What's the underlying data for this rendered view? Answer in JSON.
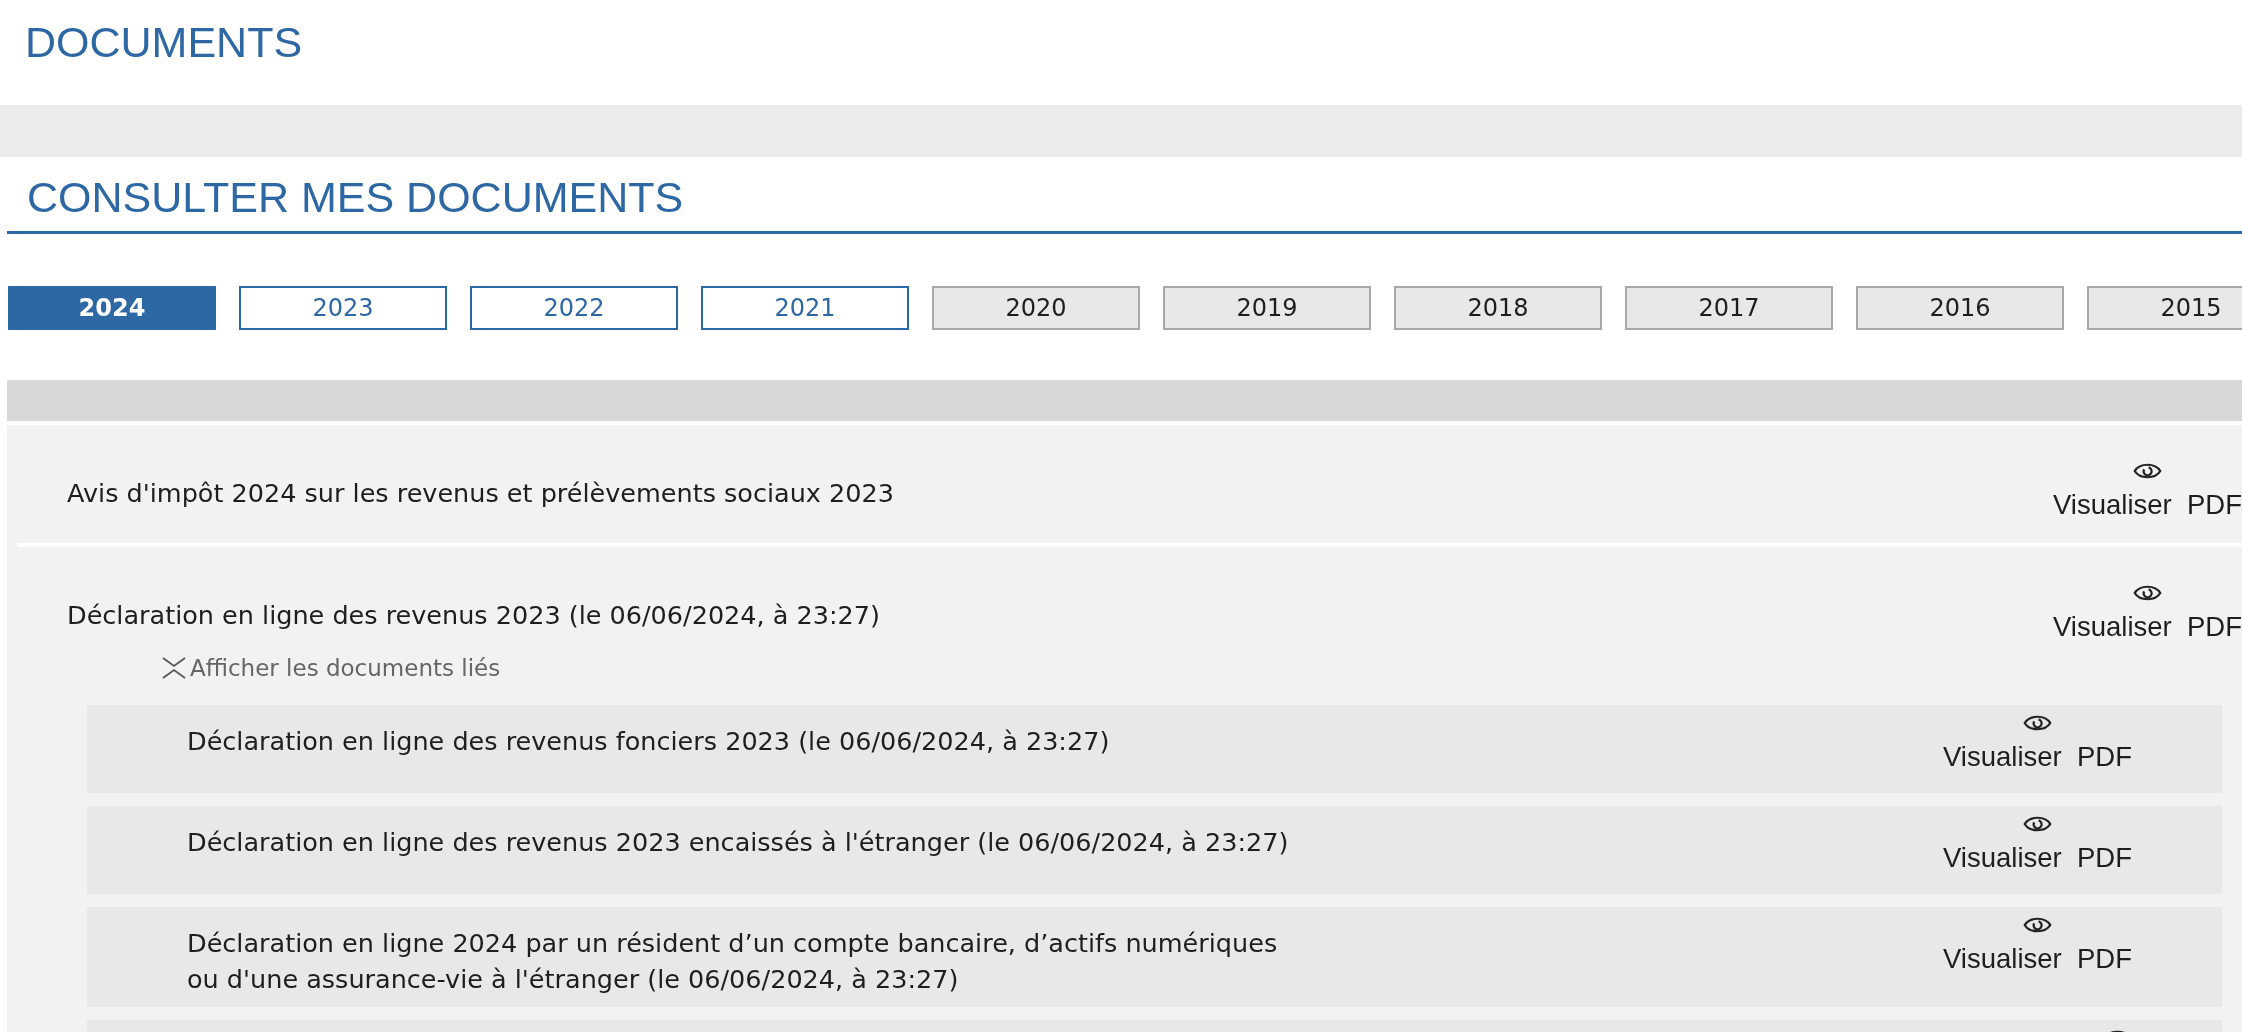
{
  "page_title": "DOCUMENTS",
  "section_title": "CONSULTER MES DOCUMENTS",
  "year_tabs": [
    {
      "label": "2024",
      "selected": true,
      "disabled": false
    },
    {
      "label": "2023",
      "selected": false,
      "disabled": false
    },
    {
      "label": "2022",
      "selected": false,
      "disabled": false
    },
    {
      "label": "2021",
      "selected": false,
      "disabled": false
    },
    {
      "label": "2020",
      "selected": false,
      "disabled": true
    },
    {
      "label": "2019",
      "selected": false,
      "disabled": true
    },
    {
      "label": "2018",
      "selected": false,
      "disabled": true
    },
    {
      "label": "2017",
      "selected": false,
      "disabled": true
    },
    {
      "label": "2016",
      "selected": false,
      "disabled": true
    },
    {
      "label": "2015",
      "selected": false,
      "disabled": true
    }
  ],
  "documents": [
    {
      "title": "Avis d'impôt 2024 sur les revenus et prélèvements sociaux 2023",
      "action": "Visualiser  PDF"
    },
    {
      "title": "Déclaration en ligne des revenus 2023 (le 06/06/2024, à 23:27)",
      "action": "Visualiser  PDF",
      "toggle": {
        "label": "Afficher les documents liés",
        "expanded": true
      },
      "children": [
        {
          "kind": "full",
          "title": "Déclaration en ligne des revenus fonciers 2023 (le 06/06/2024, à 23:27)",
          "action": "Visualiser  PDF"
        },
        {
          "kind": "full",
          "title": "Déclaration en ligne des revenus 2023 encaissés à l'étranger (le 06/06/2024, à 23:27)",
          "action": "Visualiser  PDF"
        },
        {
          "kind": "full",
          "title": "Déclaration en ligne 2024 par un résident d’un compte bancaire, d’actifs numériques\nou d'une assurance-vie à l'étranger (le 06/06/2024, à 23:27)",
          "action": "Visualiser  PDF"
        },
        {
          "kind": "cut_off"
        }
      ]
    }
  ]
}
